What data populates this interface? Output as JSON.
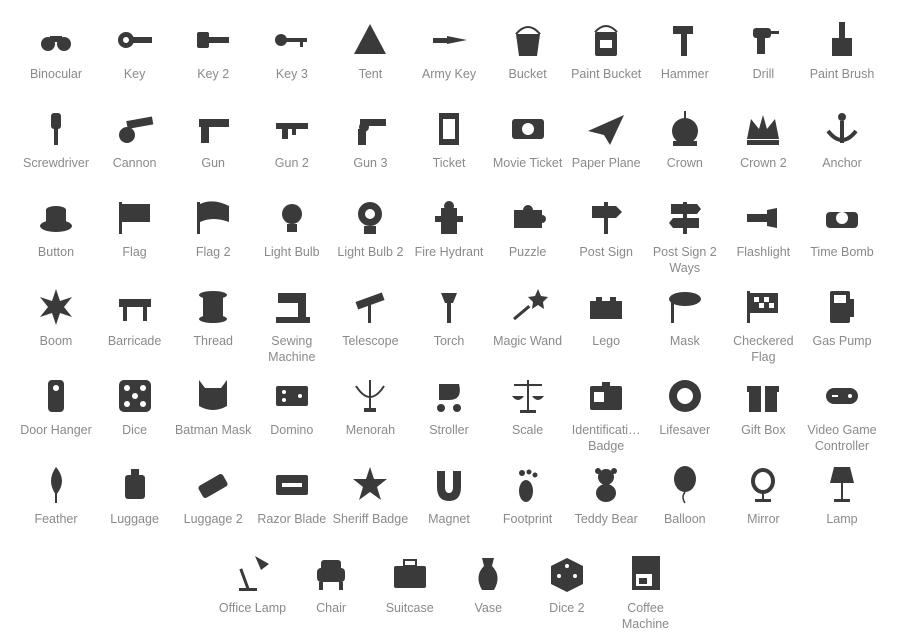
{
  "icon_color": "#3a3a3a",
  "label_color": "#8a8a8a",
  "rows": [
    [
      "Binocular",
      "Key",
      "Key 2",
      "Key 3",
      "Tent",
      "Army Key",
      "Bucket",
      "Paint Bucket",
      "Hammer",
      "Drill",
      "Paint Brush"
    ],
    [
      "Screwdriver",
      "Cannon",
      "Gun",
      "Gun 2",
      "Gun 3",
      "Ticket",
      "Movie Ticket",
      "Paper Plane",
      "Crown",
      "Crown 2",
      "Anchor"
    ],
    [
      "Button",
      "Flag",
      "Flag 2",
      "Light Bulb",
      "Light Bulb 2",
      "Fire Hydrant",
      "Puzzle",
      "Post Sign",
      "Post Sign 2 Ways",
      "Flashlight",
      "Time Bomb"
    ],
    [
      "Boom",
      "Barricade",
      "Thread",
      "Sewing Machine",
      "Telescope",
      "Torch",
      "Magic Wand",
      "Lego",
      "Mask",
      "Checkered Flag",
      "Gas Pump"
    ],
    [
      "Door Hanger",
      "Dice",
      "Batman Mask",
      "Domino",
      "Menorah",
      "Stroller",
      "Scale",
      "Identificati… Badge",
      "Lifesaver",
      "Gift Box",
      "Video Game Controller"
    ],
    [
      "Feather",
      "Luggage",
      "Luggage 2",
      "Razor Blade",
      "Sheriff Badge",
      "Magnet",
      "Footprint",
      "Teddy Bear",
      "Balloon",
      "Mirror",
      "Lamp"
    ],
    [
      "Office Lamp",
      "Chair",
      "Suitcase",
      "Vase",
      "Dice 2",
      "Coffee Machine"
    ]
  ]
}
